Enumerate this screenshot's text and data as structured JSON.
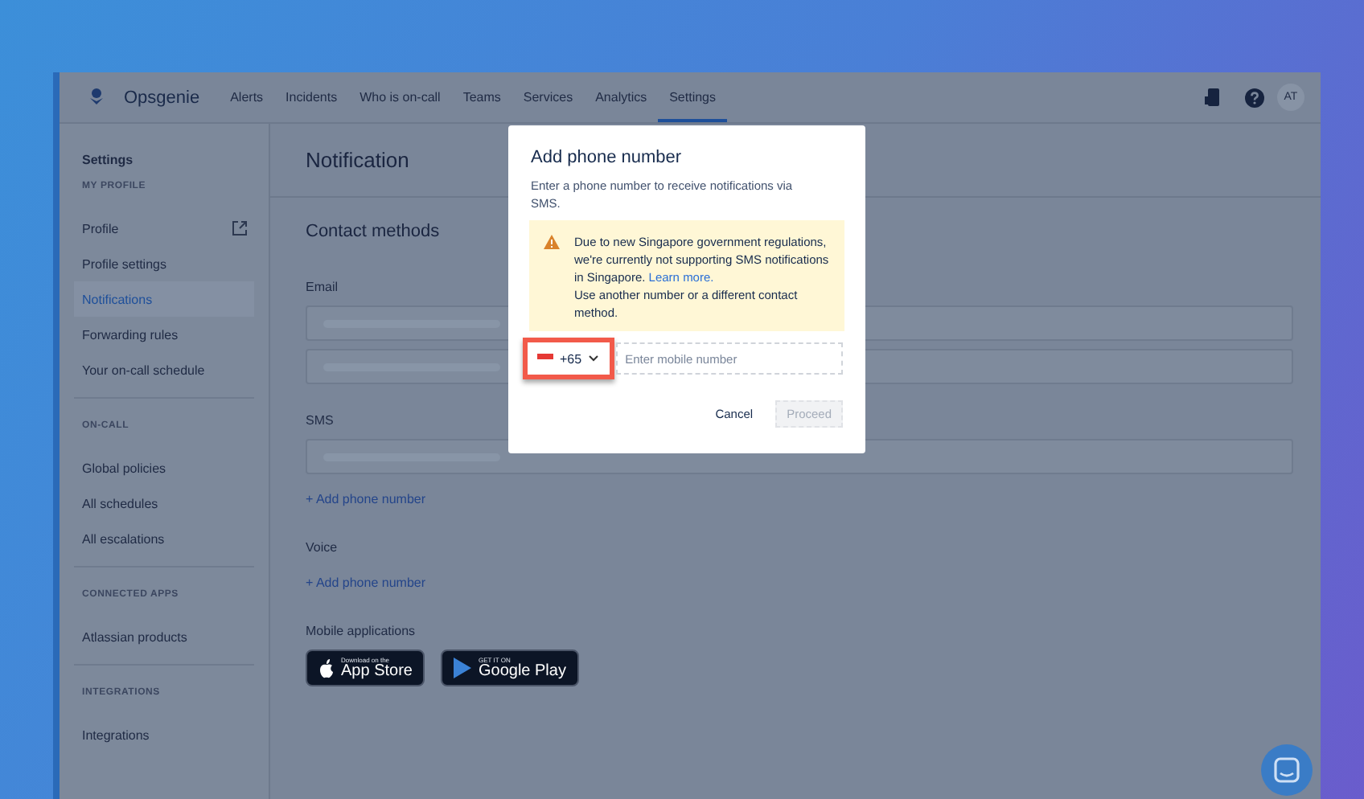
{
  "nav": {
    "logo": "Opsgenie",
    "items": [
      {
        "label": "Alerts",
        "selected": false
      },
      {
        "label": "Incidents",
        "selected": false
      },
      {
        "label": "Who is on-call",
        "selected": false
      },
      {
        "label": "Teams",
        "selected": false
      },
      {
        "label": "Services",
        "selected": false
      },
      {
        "label": "Analytics",
        "selected": false
      },
      {
        "label": "Settings",
        "selected": true
      }
    ],
    "avatar": "AT"
  },
  "sidebar": {
    "title": "Settings",
    "sections": [
      {
        "heading": "MY PROFILE",
        "items": [
          {
            "label": "Profile",
            "selected": false,
            "external": true
          },
          {
            "label": "Profile settings",
            "selected": false,
            "external": false
          },
          {
            "label": "Notifications",
            "selected": true,
            "external": false
          },
          {
            "label": "Forwarding rules",
            "selected": false,
            "external": false
          },
          {
            "label": "Your on-call schedule",
            "selected": false,
            "external": false
          }
        ]
      },
      {
        "heading": "ON-CALL",
        "items": [
          {
            "label": "Global policies",
            "selected": false,
            "external": false
          },
          {
            "label": "All schedules",
            "selected": false,
            "external": false
          },
          {
            "label": "All escalations",
            "selected": false,
            "external": false
          }
        ]
      },
      {
        "heading": "CONNECTED APPS",
        "items": [
          {
            "label": "Atlassian products",
            "selected": false,
            "external": false
          }
        ]
      },
      {
        "heading": "INTEGRATIONS",
        "items": [
          {
            "label": "Integrations",
            "selected": false,
            "external": false
          }
        ]
      }
    ]
  },
  "content": {
    "title": "Notification",
    "section": "Contact methods",
    "groups": [
      {
        "label": "Email",
        "fields": [
          {
            "kind": "masked"
          },
          {
            "kind": "masked"
          }
        ]
      },
      {
        "label": "SMS",
        "fields": [
          {
            "kind": "masked"
          }
        ],
        "link": "+ Add phone number"
      },
      {
        "label": "Voice",
        "link": "+ Add phone number"
      }
    ],
    "mobile": {
      "label": "Mobile applications",
      "badges": [
        {
          "kind": "apple",
          "small": "Download on the",
          "big": "App Store"
        },
        {
          "kind": "google",
          "small": "GET IT ON",
          "big": "Google Play"
        }
      ]
    }
  },
  "modal": {
    "title": "Add phone number",
    "description": "Enter a phone number to receive notifications via SMS.",
    "warning": {
      "text": "Due to new Singapore government regulations, we're currently not supporting SMS notifications in Singapore.",
      "link": "Learn more.",
      "text2": "Use another number or a different contact method."
    },
    "country_code": "+65",
    "highlighted": true,
    "placeholder": "Enter mobile number",
    "buttons": [
      {
        "label": "Cancel",
        "kind": "subtle",
        "disabled": false
      },
      {
        "label": "Proceed",
        "kind": "primary",
        "disabled": true
      }
    ]
  }
}
